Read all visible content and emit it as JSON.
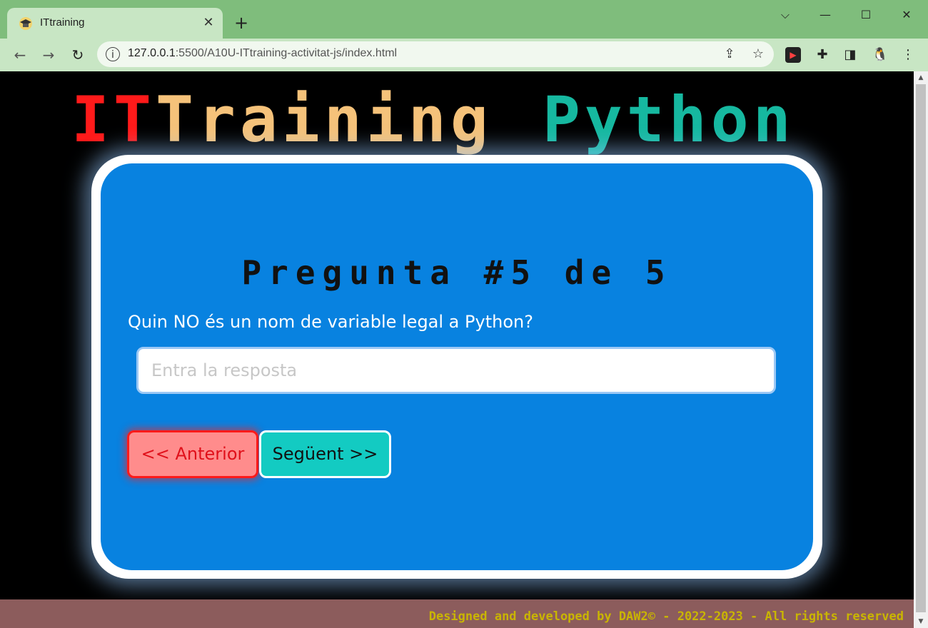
{
  "browser": {
    "tab_title": "ITtraining",
    "tab_close": "✕",
    "new_tab": "+",
    "url_host": "127.0.0.1",
    "url_rest": ":5500/A10U-ITtraining-activitat-js/index.html",
    "window_controls": {
      "menu": "⌵",
      "minimize": "—",
      "maximize": "☐",
      "close": "✕"
    },
    "nav": {
      "back": "←",
      "forward": "→",
      "reload": "↻",
      "info": "i"
    },
    "omnibox_icons": {
      "share": "⇪",
      "star": "☆"
    },
    "extensions": {
      "terminal": "▶",
      "puzzle": "✚",
      "sidepanel": "◨",
      "linux": "🐧",
      "menu": "⋮"
    }
  },
  "banner": {
    "it": "IT",
    "training": "Training",
    "python": "Python"
  },
  "quiz": {
    "title": "Pregunta #5 de 5",
    "question": "Quin NO és un nom de variable legal a Python?",
    "answer_value": "",
    "answer_placeholder": "Entra la resposta",
    "prev_label": "<< Anterior",
    "next_label": "Següent >>"
  },
  "footer": {
    "text": "Designed and developed by DAW2© - 2022-2023 - All rights reserved"
  },
  "colors": {
    "chrome": "#7fbd7c",
    "card": "#0882e0",
    "banner_it": "#ff1a1a",
    "banner_training": "#f5c27a",
    "banner_python": "#16b8a0",
    "prev_button": "#ff8c8c",
    "next_button": "#13cbc2",
    "footer_bg": "#8c5c5c",
    "footer_text": "#c9b500"
  }
}
